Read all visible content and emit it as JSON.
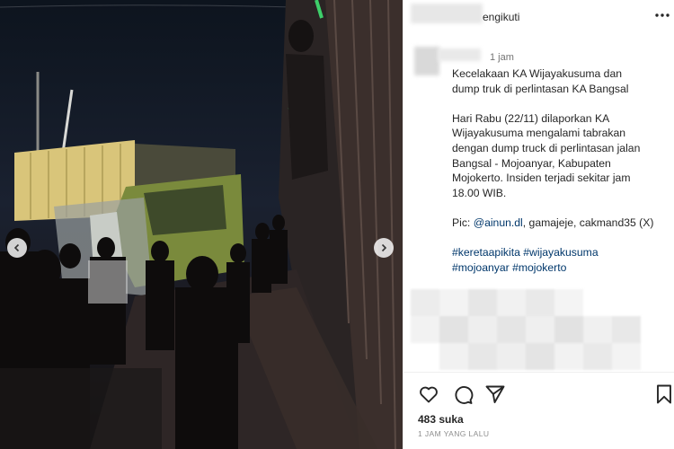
{
  "post": {
    "follow_status": "engikuti",
    "time_ago": "1 jam",
    "caption_lines": [
      "Kecelakaan KA Wijayakusuma dan",
      "dump truk di perlintasan KA Bangsal",
      "",
      "Hari Rabu (22/11) dilaporkan KA",
      "Wijayakusuma mengalami tabrakan",
      "dengan dump truck di perlintasan jalan",
      "Bangsal - Mojoanyar, Kabupaten",
      "Mojokerto. Insiden terjadi sekitar jam",
      "18.00 WIB."
    ],
    "credit_prefix": "Pic: ",
    "credit_mention": "@ainun.dl",
    "credit_rest": ", gamajeje, cakmand35 (X)",
    "hashtags_line1": [
      "#keretaapikita",
      "#wijayakusuma"
    ],
    "hashtags_line2": [
      "#mojoanyar",
      "#mojokerto"
    ],
    "likes": "483 suka",
    "posted_ago": "1 JAM YANG LALU"
  },
  "icons": {
    "more": "more-horizontal-icon",
    "like": "heart-icon",
    "comment": "comment-icon",
    "share": "send-icon",
    "save": "bookmark-icon",
    "prev": "chevron-left-icon",
    "next": "chevron-right-icon"
  },
  "colors": {
    "link": "#00376b",
    "text": "#262626",
    "muted": "#8e8e8e"
  }
}
